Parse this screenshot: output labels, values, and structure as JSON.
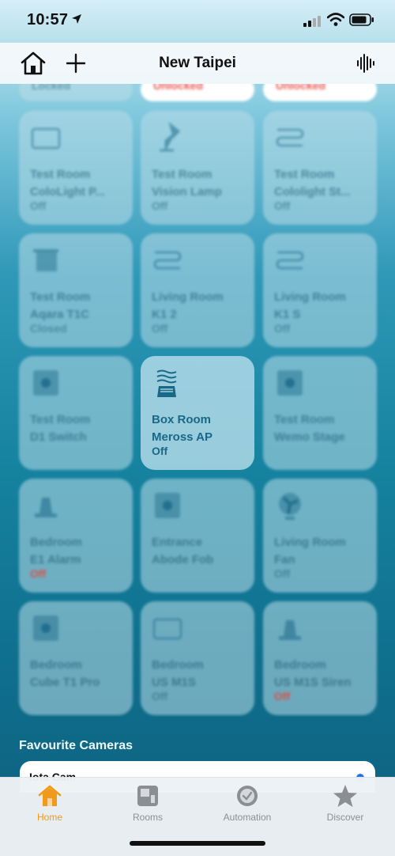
{
  "status_bar": {
    "time": "10:57"
  },
  "nav": {
    "title": "New Taipei"
  },
  "tiles_top_partial": [
    {
      "state": "Locked",
      "red": false
    },
    {
      "state": "Unlocked",
      "red": true
    },
    {
      "state": "Unlocked",
      "red": true
    }
  ],
  "tiles": [
    {
      "room": "Test Room",
      "name": "ColoLight P...",
      "state": "Off",
      "red": false,
      "icon": "light-panel-icon"
    },
    {
      "room": "Test Room",
      "name": "Vision Lamp",
      "state": "Off",
      "red": false,
      "icon": "desk-lamp-icon"
    },
    {
      "room": "Test Room",
      "name": "Cololight St...",
      "state": "Off",
      "red": false,
      "icon": "light-strip-icon"
    },
    {
      "room": "Test Room",
      "name": "Aqara T1C",
      "state": "Closed",
      "red": false,
      "icon": "blind-icon"
    },
    {
      "room": "Living Room",
      "name": "K1 2",
      "state": "Off",
      "red": false,
      "icon": "light-strip-icon"
    },
    {
      "room": "Living Room",
      "name": "K1 S",
      "state": "Off",
      "red": false,
      "icon": "light-strip-icon"
    },
    {
      "room": "Test Room",
      "name": "D1 Switch",
      "state": "",
      "red": false,
      "icon": "switch-icon"
    },
    {
      "room": "Box Room",
      "name": "Meross AP",
      "state": "Off",
      "red": false,
      "icon": "air-purifier-icon",
      "focus": true
    },
    {
      "room": "Test Room",
      "name": "Wemo Stage",
      "state": "",
      "red": false,
      "icon": "switch-icon"
    },
    {
      "room": "Bedroom",
      "name": "E1 Alarm",
      "state": "Off",
      "red": true,
      "icon": "siren-icon"
    },
    {
      "room": "Entrance",
      "name": "Abode Fob",
      "state": "",
      "red": false,
      "icon": "switch-icon"
    },
    {
      "room": "Living Room",
      "name": "Fan",
      "state": "Off",
      "red": false,
      "icon": "fan-icon"
    },
    {
      "room": "Bedroom",
      "name": "Cube T1 Pro",
      "state": "",
      "red": false,
      "icon": "switch-icon"
    },
    {
      "room": "Bedroom",
      "name": "US M1S",
      "state": "Off",
      "red": false,
      "icon": "light-panel-icon"
    },
    {
      "room": "Bedroom",
      "name": "US M1S Siren",
      "state": "Off",
      "red": true,
      "icon": "siren-icon"
    }
  ],
  "favourites": {
    "title": "Favourite Cameras",
    "camera_name": "Iota Cam"
  },
  "tabs": [
    {
      "label": "Home",
      "icon": "home-tab-icon",
      "active": true
    },
    {
      "label": "Rooms",
      "icon": "rooms-tab-icon",
      "active": false
    },
    {
      "label": "Automation",
      "icon": "automation-tab-icon",
      "active": false
    },
    {
      "label": "Discover",
      "icon": "discover-tab-icon",
      "active": false
    }
  ],
  "colors": {
    "accent": "#ef9a1a",
    "tile_text": "#1a6888",
    "alert": "#e6463c"
  }
}
